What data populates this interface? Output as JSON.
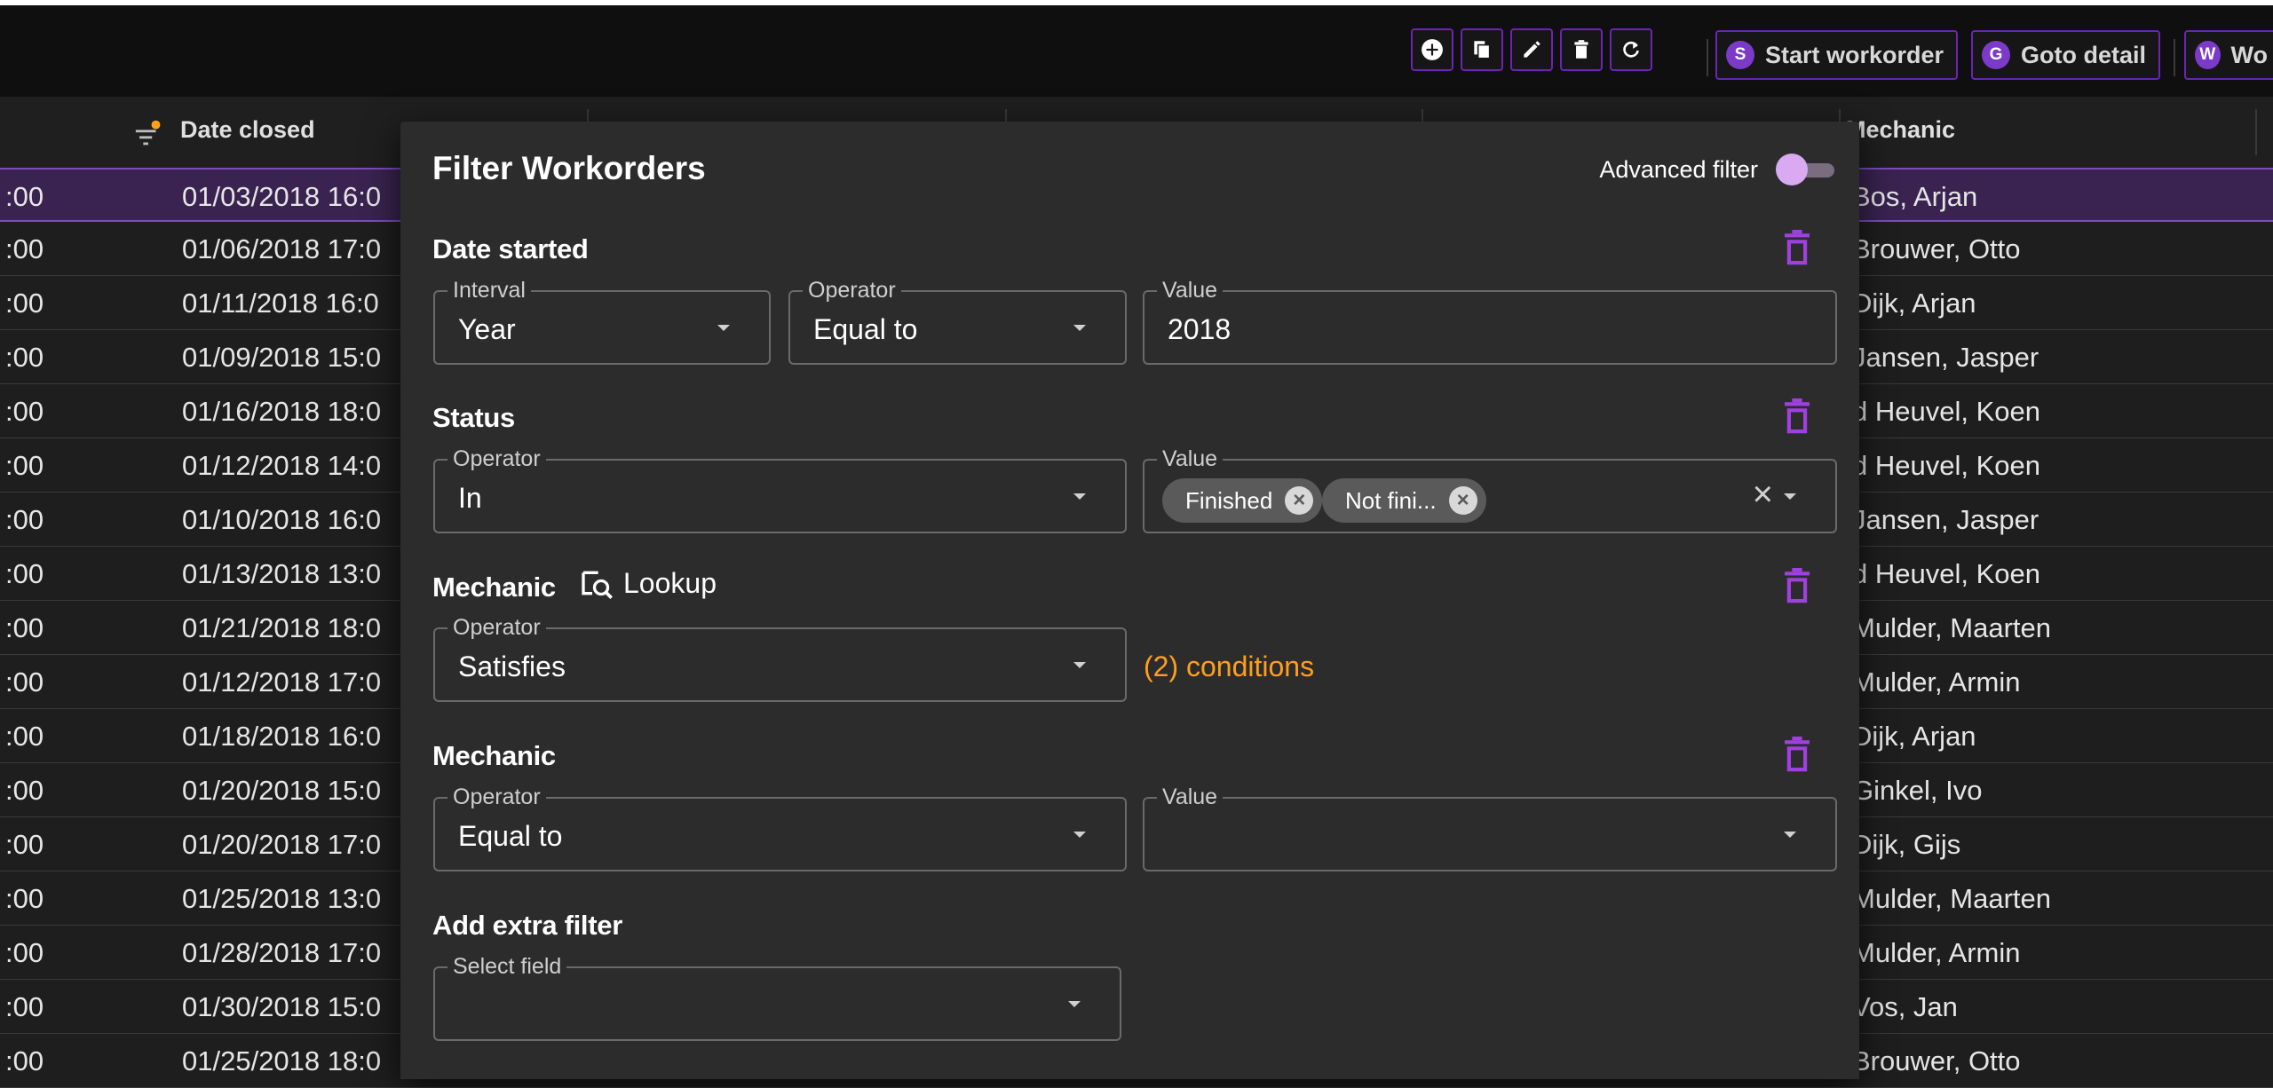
{
  "toolbar": {
    "buttons": [
      {
        "letter": "S",
        "label": "Start workorder"
      },
      {
        "letter": "G",
        "label": "Goto detail"
      },
      {
        "letter": "W",
        "label": "Wo"
      }
    ]
  },
  "table": {
    "headers": {
      "date_closed": "Date closed",
      "mechanic": "Mechanic"
    },
    "rows": [
      {
        "time": ":00",
        "date_closed": "01/03/2018 16:0",
        "mechanic": "Bos, Arjan"
      },
      {
        "time": ":00",
        "date_closed": "01/06/2018 17:0",
        "mechanic": "Brouwer, Otto"
      },
      {
        "time": ":00",
        "date_closed": "01/11/2018 16:0",
        "mechanic": "Dijk, Arjan"
      },
      {
        "time": ":00",
        "date_closed": "01/09/2018 15:0",
        "mechanic": "Jansen, Jasper"
      },
      {
        "time": ":00",
        "date_closed": "01/16/2018 18:0",
        "mechanic": "d Heuvel, Koen"
      },
      {
        "time": ":00",
        "date_closed": "01/12/2018 14:0",
        "mechanic": "d Heuvel, Koen"
      },
      {
        "time": ":00",
        "date_closed": "01/10/2018 16:0",
        "mechanic": "Jansen, Jasper"
      },
      {
        "time": ":00",
        "date_closed": "01/13/2018 13:0",
        "mechanic": "d Heuvel, Koen"
      },
      {
        "time": ":00",
        "date_closed": "01/21/2018 18:0",
        "mechanic": "Mulder, Maarten"
      },
      {
        "time": ":00",
        "date_closed": "01/12/2018 17:0",
        "mechanic": "Mulder, Armin"
      },
      {
        "time": ":00",
        "date_closed": "01/18/2018 16:0",
        "mechanic": "Dijk, Arjan"
      },
      {
        "time": ":00",
        "date_closed": "01/20/2018 15:0",
        "mechanic": "Ginkel, Ivo"
      },
      {
        "time": ":00",
        "date_closed": "01/20/2018 17:0",
        "mechanic": "Dijk, Gijs"
      },
      {
        "time": ":00",
        "date_closed": "01/25/2018 13:0",
        "mechanic": "Mulder, Maarten"
      },
      {
        "time": ":00",
        "date_closed": "01/28/2018 17:0",
        "mechanic": "Mulder, Armin"
      },
      {
        "time": ":00",
        "date_closed": "01/30/2018 15:0",
        "mechanic": "Vos, Jan"
      },
      {
        "time": ":00",
        "date_closed": "01/25/2018 18:0",
        "mechanic": "Brouwer, Otto"
      }
    ]
  },
  "dialog": {
    "title": "Filter Workorders",
    "advanced_filter_label": "Advanced filter",
    "date_started": {
      "title": "Date started",
      "interval_label": "Interval",
      "interval_value": "Year",
      "operator_label": "Operator",
      "operator_value": "Equal to",
      "value_label": "Value",
      "value": "2018"
    },
    "status": {
      "title": "Status",
      "operator_label": "Operator",
      "operator_value": "In",
      "value_label": "Value",
      "chips": [
        "Finished",
        "Not fini..."
      ]
    },
    "mechanic_lookup": {
      "title": "Mechanic",
      "lookup_label": "Lookup",
      "operator_label": "Operator",
      "operator_value": "Satisfies",
      "conditions": "(2) conditions"
    },
    "mechanic": {
      "title": "Mechanic",
      "operator_label": "Operator",
      "operator_value": "Equal to",
      "value_label": "Value",
      "value": ""
    },
    "add_extra": {
      "title": "Add extra filter",
      "select_label": "Select field"
    }
  },
  "colors": {
    "accent": "#7b3ac8",
    "trash": "#a040e0",
    "conditions": "#ff9f1c",
    "selected_row": "#3a2350"
  }
}
